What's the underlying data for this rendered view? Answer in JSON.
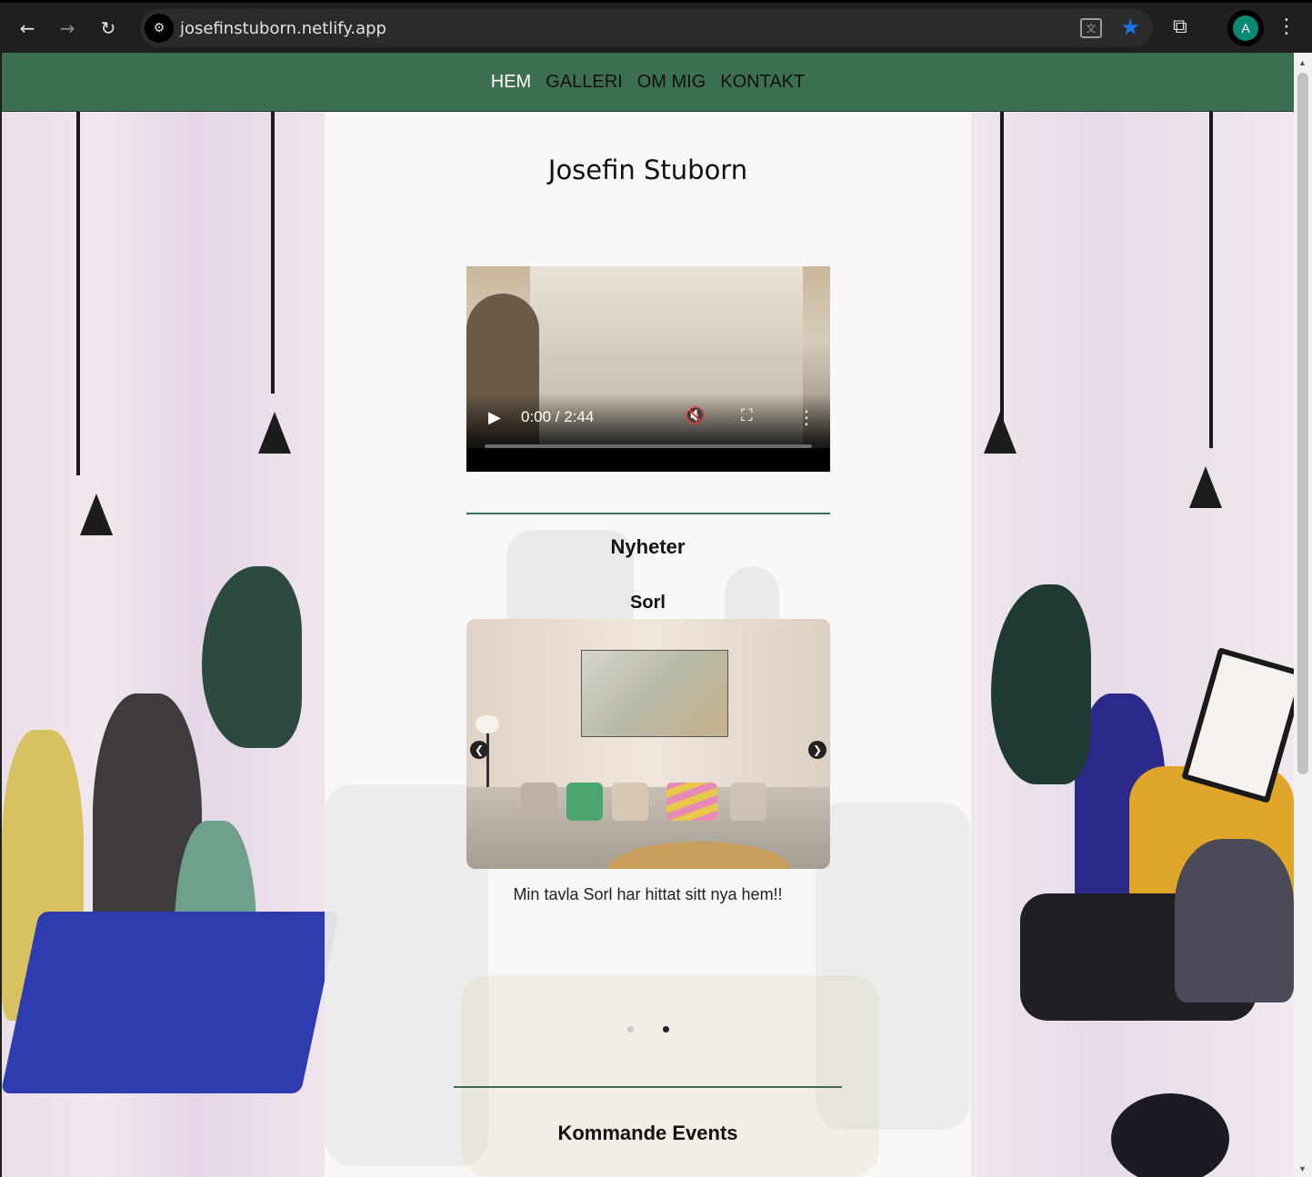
{
  "browser": {
    "url": "josefinstuborn.netlify.app",
    "profile_initial": "A",
    "icons": {
      "back": "arrow-left-icon",
      "forward": "arrow-right-icon",
      "reload": "reload-icon",
      "site_info": "tune-icon",
      "translate": "translate-icon",
      "bookmark": "star-icon",
      "extensions": "puzzle-icon",
      "menu": "kebab-menu-icon"
    },
    "accent_color": "#1a73e8"
  },
  "nav": {
    "items": [
      {
        "label": "HEM",
        "active": true
      },
      {
        "label": "GALLERI",
        "active": false
      },
      {
        "label": "OM MIG",
        "active": false
      },
      {
        "label": "KONTAKT",
        "active": false
      }
    ],
    "background_color": "#3c6e52"
  },
  "hero": {
    "title": "Josefin Stuborn"
  },
  "video": {
    "time": "0:00 / 2:44",
    "muted": true
  },
  "news": {
    "heading": "Nyheter",
    "slide_title": "Sorl",
    "slide_caption": "Min tavla Sorl har hittat sitt nya hem!!",
    "active_slide": 2,
    "slide_count": 2
  },
  "events": {
    "heading": "Kommande Events"
  }
}
